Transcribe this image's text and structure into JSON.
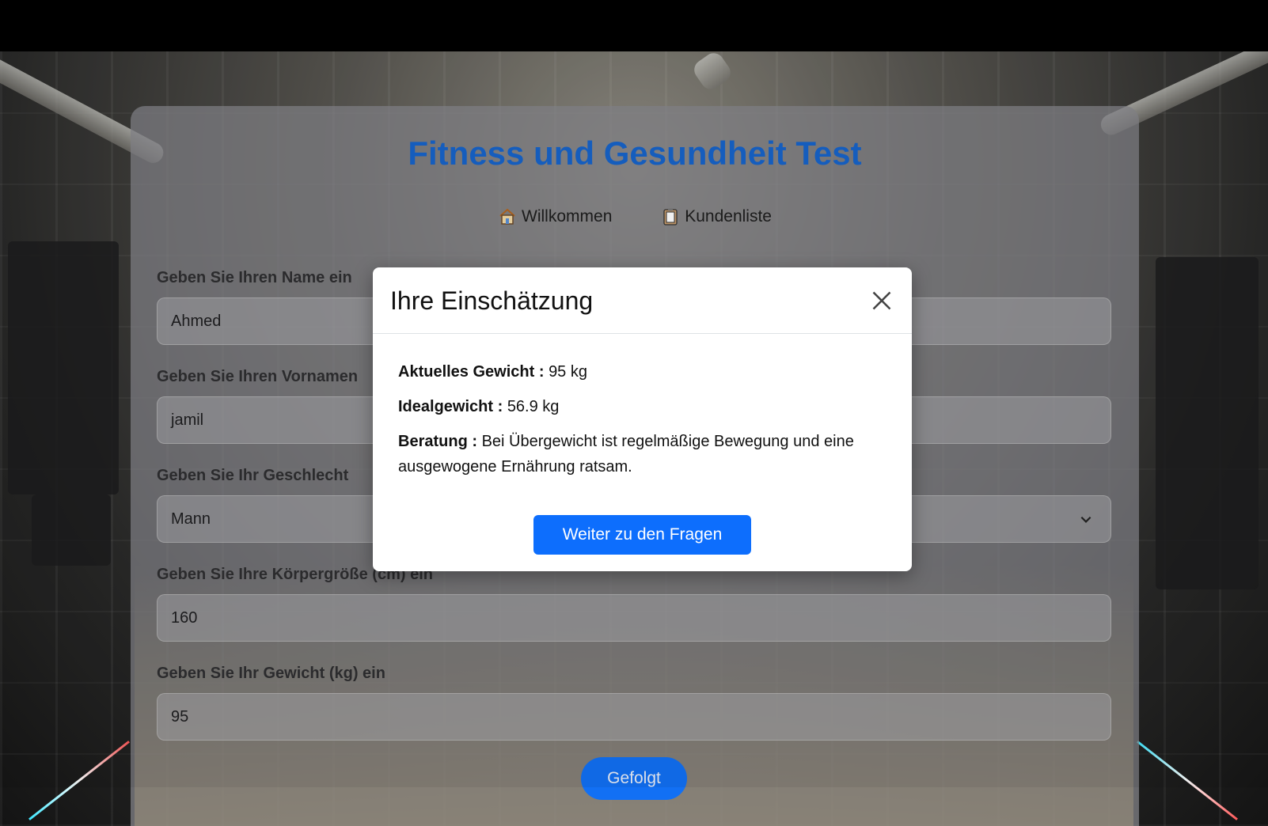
{
  "page": {
    "title": "Fitness und Gesundheit Test"
  },
  "nav": {
    "items": [
      {
        "label": "Willkommen",
        "icon": "house-icon"
      },
      {
        "label": "Kundenliste",
        "icon": "clipboard-icon"
      }
    ]
  },
  "form": {
    "name_label": "Geben Sie Ihren Name ein",
    "name_value": "Ahmed",
    "vorname_label": "Geben Sie Ihren Vornamen",
    "vorname_value": "jamil",
    "geschlecht_label": "Geben Sie Ihr Geschlecht",
    "geschlecht_value": "Mann",
    "groesse_label": "Geben Sie Ihre Körpergröße (cm) ein",
    "groesse_value": "160",
    "gewicht_label": "Geben Sie Ihr Gewicht (kg) ein",
    "gewicht_value": "95",
    "submit_label": "Gefolgt"
  },
  "modal": {
    "title": "Ihre Einschätzung",
    "aktuell_label": "Aktuelles Gewicht :",
    "aktuell_value": "95 kg",
    "ideal_label": "Idealgewicht :",
    "ideal_value": "56.9 kg",
    "beratung_label": "Beratung :",
    "beratung_value": "Bei Übergewicht ist regelmäßige Bewegung und eine ausgewogene Ernährung ratsam.",
    "button_label": "Weiter zu den Fragen"
  },
  "colors": {
    "title": "#1763c9",
    "primary_button": "#0d6efd"
  }
}
